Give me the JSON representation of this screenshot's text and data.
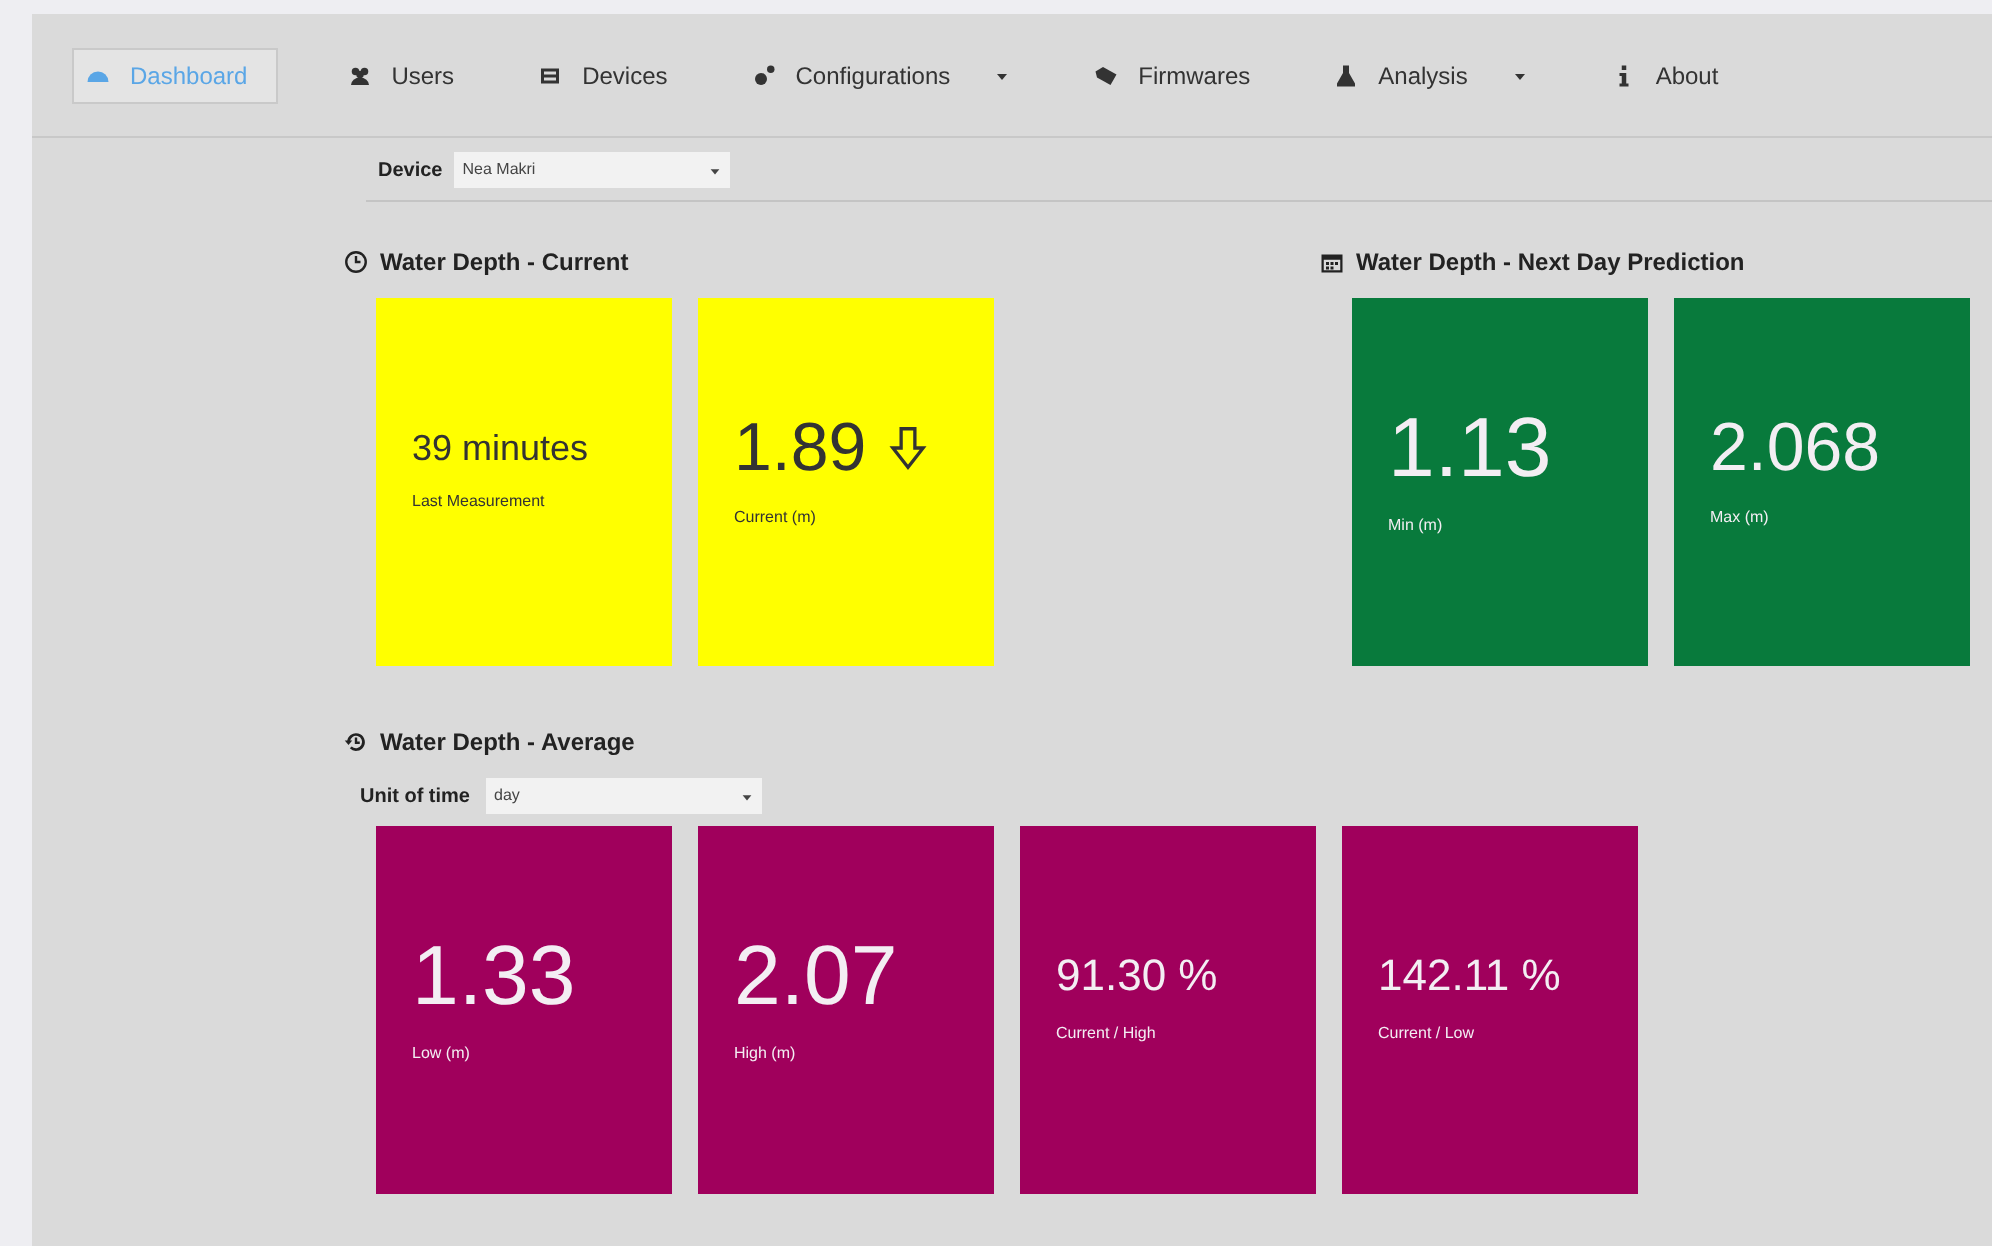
{
  "nav": [
    {
      "label": "Dashboard",
      "selected": true,
      "dropdown": false
    },
    {
      "label": "Users",
      "selected": false,
      "dropdown": false
    },
    {
      "label": "Devices",
      "selected": false,
      "dropdown": false
    },
    {
      "label": "Configurations",
      "selected": false,
      "dropdown": true
    },
    {
      "label": "Firmwares",
      "selected": false,
      "dropdown": false
    },
    {
      "label": "Analysis",
      "selected": false,
      "dropdown": true
    },
    {
      "label": "About",
      "selected": false,
      "dropdown": false
    }
  ],
  "device_select": {
    "label": "Device",
    "value": "Nea Makri"
  },
  "sections": [
    {
      "title": "Water Depth - Current",
      "color": "#ffff00",
      "cards": [
        {
          "kind": "plain",
          "value": "39 minutes",
          "label": "Last Measurement"
        },
        {
          "kind": "falling",
          "value": "1.89",
          "label": "Current (m)"
        }
      ]
    },
    {
      "title": "Water Depth - Next Day Prediction",
      "color": "#087a3c",
      "cards": [
        {
          "kind": "plain",
          "value": "1.13",
          "label": "Min (m)"
        },
        {
          "kind": "plain",
          "value": "2.068",
          "label": "Max (m)"
        }
      ]
    },
    {
      "title": "Water Depth - Average",
      "color": "#a0005c",
      "select": {
        "label": "Unit of time",
        "value": "day"
      },
      "cards": [
        {
          "kind": "plain",
          "value": "1.33",
          "label": "Low (m)"
        },
        {
          "kind": "plain",
          "value": "2.07",
          "label": "High (m)"
        },
        {
          "kind": "plain",
          "value": "91.30 %",
          "label": "Current / High"
        },
        {
          "kind": "plain",
          "value": "142.11 %",
          "label": "Current / Low"
        }
      ]
    }
  ]
}
